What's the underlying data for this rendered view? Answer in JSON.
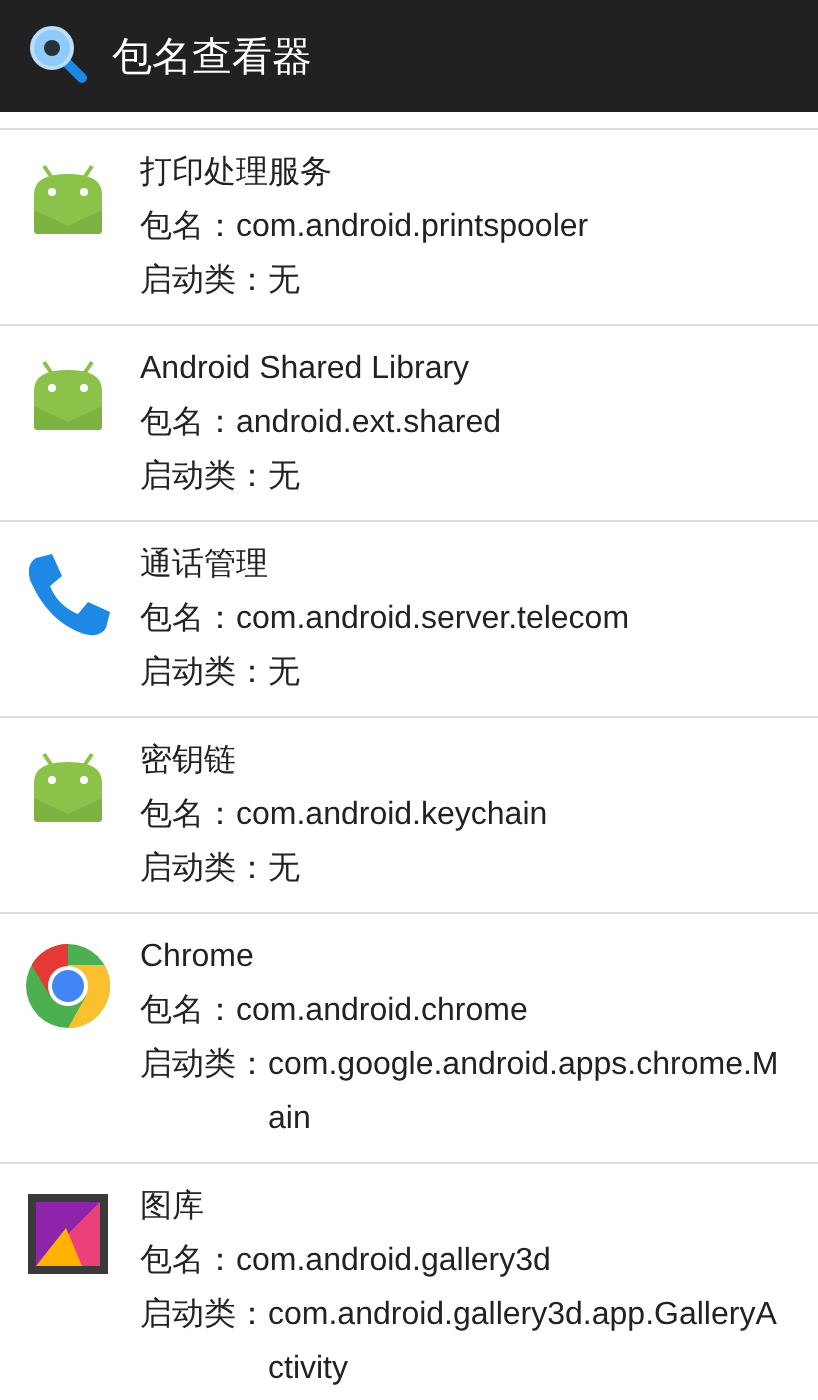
{
  "app_bar": {
    "title": "包名查看器"
  },
  "packages": [
    {
      "kind": "android",
      "name": "打印处理服务",
      "package_label": "包名：",
      "package": "com.android.printspooler",
      "launcher_label": "启动类：",
      "launcher": "无"
    },
    {
      "kind": "android",
      "name": "Android Shared Library",
      "package_label": "包名：",
      "package": "android.ext.shared",
      "launcher_label": "启动类：",
      "launcher": "无"
    },
    {
      "kind": "phone",
      "name": "通话管理",
      "package_label": "包名：",
      "package": "com.android.server.telecom",
      "launcher_label": "启动类：",
      "launcher": "无"
    },
    {
      "kind": "android",
      "name": "密钥链",
      "package_label": "包名：",
      "package": "com.android.keychain",
      "launcher_label": "启动类：",
      "launcher": "无"
    },
    {
      "kind": "chrome",
      "name": "Chrome",
      "package_label": "包名：",
      "package": "com.android.chrome",
      "launcher_label": "启动类：",
      "launcher": "com.google.android.apps.chrome.Main"
    },
    {
      "kind": "gallery",
      "name": "图库",
      "package_label": "包名：",
      "package": "com.android.gallery3d",
      "launcher_label": "启动类：",
      "launcher": "com.android.gallery3d.app.GalleryActivity"
    }
  ]
}
